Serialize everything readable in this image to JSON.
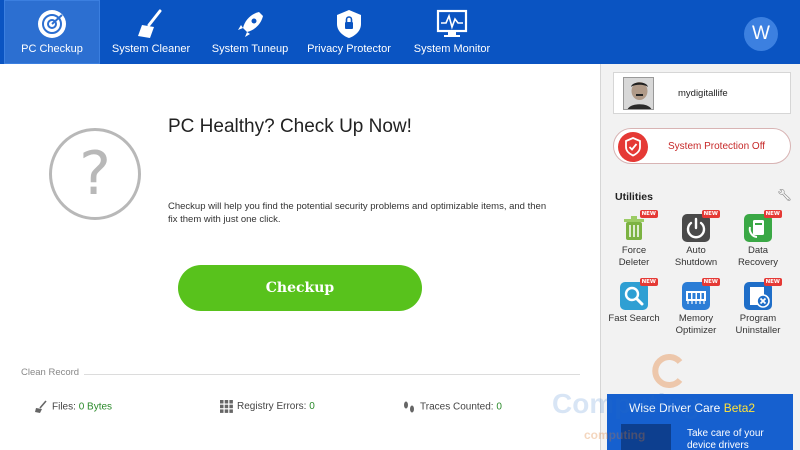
{
  "tabs": [
    {
      "label": "PC Checkup",
      "icon": "pc-checkup-icon",
      "active": true
    },
    {
      "label": "System Cleaner",
      "icon": "broom-icon"
    },
    {
      "label": "System Tuneup",
      "icon": "rocket-icon"
    },
    {
      "label": "Privacy Protector",
      "icon": "shield-icon"
    },
    {
      "label": "System Monitor",
      "icon": "monitor-icon"
    }
  ],
  "brand_logo": "W",
  "main": {
    "headline": "PC Healthy? Check Up Now!",
    "description": "Checkup will help you find the potential security problems and optimizable items, and then fix them with just one click.",
    "checkup_button": "Checkup",
    "clean_record_title": "Clean Record",
    "stats": [
      {
        "label": "Files:",
        "value": "0 Bytes",
        "icon": "broom-icon"
      },
      {
        "label": "Registry Errors:",
        "value": "0",
        "icon": "registry-icon"
      },
      {
        "label": "Traces Counted:",
        "value": "0",
        "icon": "footprints-icon"
      }
    ]
  },
  "sidebar": {
    "username": "mydigitallife",
    "protection_status": "System Protection Off",
    "utilities_title": "Utilities",
    "new_badge": "NEW",
    "utilities": [
      {
        "label_line1": "Force",
        "label_line2": "Deleter",
        "icon": "trash-icon",
        "color": "#6aa84f"
      },
      {
        "label_line1": "Auto",
        "label_line2": "Shutdown",
        "icon": "power-icon",
        "color": "#4a4a4a"
      },
      {
        "label_line1": "Data",
        "label_line2": "Recovery",
        "icon": "data-recovery-icon",
        "color": "#3aa845"
      },
      {
        "label_line1": "Fast Search",
        "label_line2": "",
        "icon": "magnifier-icon",
        "color": "#2f9fd3"
      },
      {
        "label_line1": "Memory",
        "label_line2": "Optimizer",
        "icon": "memory-icon",
        "color": "#2b7dd6"
      },
      {
        "label_line1": "Program",
        "label_line2": "Uninstaller",
        "icon": "uninstaller-icon",
        "color": "#1f6ec8"
      }
    ],
    "promo": {
      "title": "Wise Driver Care ",
      "title_badge": "Beta2",
      "line1": "Take care of your",
      "line2": "device drivers"
    }
  },
  "watermark": {
    "line1": "Computing",
    "line2": "computing"
  }
}
